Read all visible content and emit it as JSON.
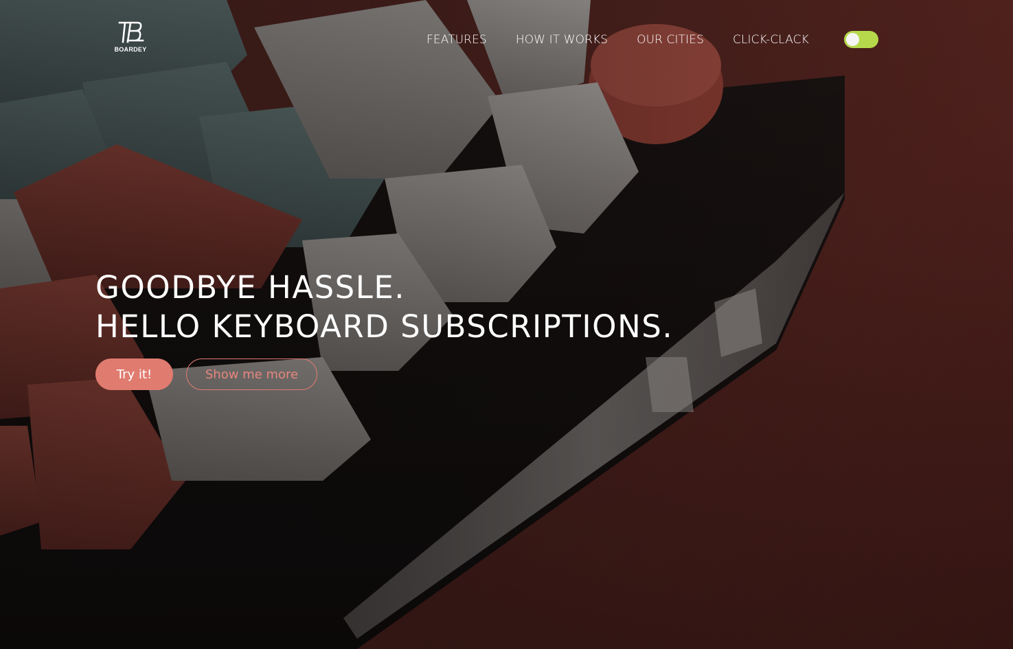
{
  "brand": {
    "name": "BOARDEY",
    "logo_icon": "boardey-monogram-icon"
  },
  "nav": {
    "items": [
      {
        "label": "FEATURES"
      },
      {
        "label": "HOW IT WORKS"
      },
      {
        "label": "OUR CITIES"
      },
      {
        "label": "CLICK-CLACK"
      }
    ],
    "theme_toggle": {
      "icon": "toggle-switch",
      "state": "on",
      "color": "#b6d94c"
    }
  },
  "hero": {
    "headline_line1": "GOODBYE HASSLE.",
    "headline_line2": "HELLO KEYBOARD SUBSCRIPTIONS.",
    "primary_cta": "Try it!",
    "secondary_cta": "Show me more",
    "accent_color": "#e07b70",
    "background_image": "mechanical-keyboard-photo"
  }
}
